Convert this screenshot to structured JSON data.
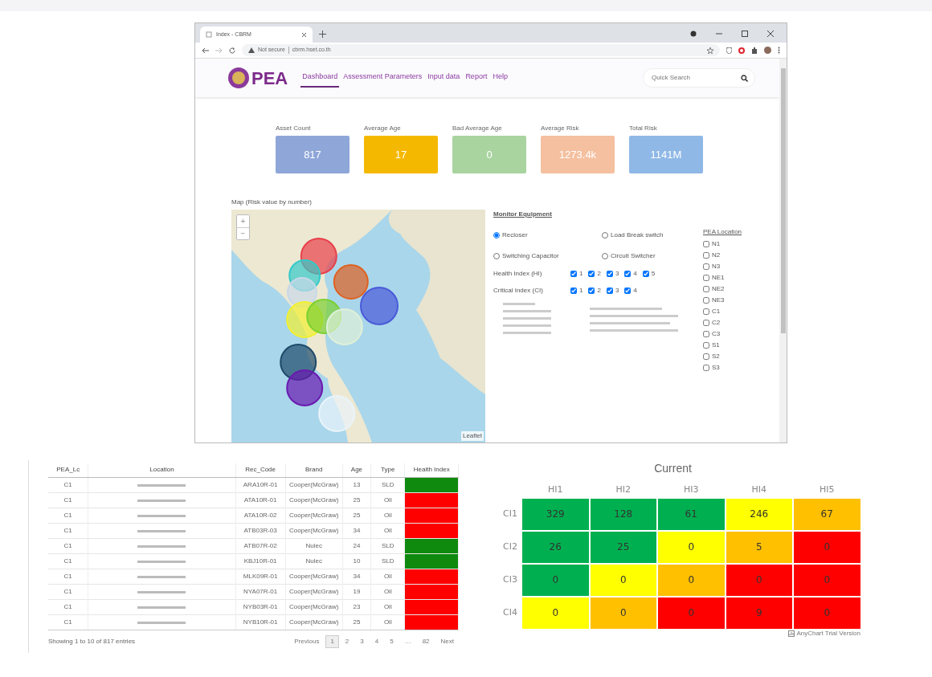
{
  "browser": {
    "tab_title": "Index - CBRM",
    "address_security": "Not secure",
    "address_url": "cbrm.hset.co.th"
  },
  "navbar": {
    "logo_text": "PEA",
    "links": [
      {
        "label": "Dashboard",
        "selected": true
      },
      {
        "label": "Assessment Parameters",
        "selected": false
      },
      {
        "label": "Input data",
        "selected": false
      },
      {
        "label": "Report",
        "selected": false
      },
      {
        "label": "Help",
        "selected": false
      }
    ],
    "search": {
      "placeholder": "Quick Search"
    }
  },
  "kpis": [
    {
      "label": "Asset Count",
      "value": "817",
      "color": "#8fa6d8"
    },
    {
      "label": "Average Age",
      "value": "17",
      "color": "#f5b800"
    },
    {
      "label": "Bad Average Age",
      "value": "0",
      "color": "#a9d4a0"
    },
    {
      "label": "Average Risk",
      "value": "1273.4k",
      "color": "#f4c0a0"
    },
    {
      "label": "Total Risk",
      "value": "1141M",
      "color": "#8fb8e6"
    }
  ],
  "map": {
    "title": "Map (Risk value by number)",
    "zoom_in": "+",
    "zoom_out": "−",
    "attribution": "Leaflet"
  },
  "monitor": {
    "title": "Monitor Equipment",
    "equipment": [
      {
        "label": "Recloser",
        "selected": true
      },
      {
        "label": "Load Break switch",
        "selected": false
      },
      {
        "label": "Switching Capacitor",
        "selected": false
      },
      {
        "label": "Circuit Switcher",
        "selected": false
      }
    ],
    "health_index": {
      "label": "Health Index (HI)",
      "options": [
        {
          "label": "1",
          "checked": true
        },
        {
          "label": "2",
          "checked": true
        },
        {
          "label": "3",
          "checked": true
        },
        {
          "label": "4",
          "checked": true
        },
        {
          "label": "5",
          "checked": true
        }
      ]
    },
    "critical_index": {
      "label": "Critical Index (CI)",
      "options": [
        {
          "label": "1",
          "checked": true
        },
        {
          "label": "2",
          "checked": true
        },
        {
          "label": "3",
          "checked": true
        },
        {
          "label": "4",
          "checked": true
        }
      ]
    },
    "location_title": "PEA Location",
    "locations": [
      {
        "label": "N1",
        "checked": false
      },
      {
        "label": "N2",
        "checked": false
      },
      {
        "label": "N3",
        "checked": false
      },
      {
        "label": "NE1",
        "checked": false
      },
      {
        "label": "NE2",
        "checked": false
      },
      {
        "label": "NE3",
        "checked": false
      },
      {
        "label": "C1",
        "checked": false
      },
      {
        "label": "C2",
        "checked": false
      },
      {
        "label": "C3",
        "checked": false
      },
      {
        "label": "S1",
        "checked": false
      },
      {
        "label": "S2",
        "checked": false
      },
      {
        "label": "S3",
        "checked": false
      }
    ]
  },
  "table": {
    "columns": [
      "PEA_Lc",
      "Location",
      "Rec_Code",
      "Brand",
      "Age",
      "Type",
      "Health Index"
    ],
    "rows": [
      {
        "pea_lc": "C1",
        "rec_code": "ARA10R-01",
        "brand": "Cooper(McGraw)",
        "age": "13",
        "type": "SLD",
        "color": "#0f8a0f"
      },
      {
        "pea_lc": "C1",
        "rec_code": "ATA10R-01",
        "brand": "Cooper(McGraw)",
        "age": "25",
        "type": "Oil",
        "color": "#ff0000"
      },
      {
        "pea_lc": "C1",
        "rec_code": "ATA10R-02",
        "brand": "Cooper(McGraw)",
        "age": "25",
        "type": "Oil",
        "color": "#ff0000"
      },
      {
        "pea_lc": "C1",
        "rec_code": "ATB03R-03",
        "brand": "Cooper(McGraw)",
        "age": "34",
        "type": "Oil",
        "color": "#ff0000"
      },
      {
        "pea_lc": "C1",
        "rec_code": "ATB07R-02",
        "brand": "Nulec",
        "age": "24",
        "type": "SLD",
        "color": "#0f8a0f"
      },
      {
        "pea_lc": "C1",
        "rec_code": "KBJ10R-01",
        "brand": "Nulec",
        "age": "10",
        "type": "SLD",
        "color": "#0f8a0f"
      },
      {
        "pea_lc": "C1",
        "rec_code": "MLK09R-01",
        "brand": "Cooper(McGraw)",
        "age": "34",
        "type": "Oil",
        "color": "#ff0000"
      },
      {
        "pea_lc": "C1",
        "rec_code": "NYA07R-01",
        "brand": "Cooper(McGraw)",
        "age": "19",
        "type": "Oil",
        "color": "#ff0000"
      },
      {
        "pea_lc": "C1",
        "rec_code": "NYB03R-01",
        "brand": "Cooper(McGraw)",
        "age": "23",
        "type": "Oil",
        "color": "#ff0000"
      },
      {
        "pea_lc": "C1",
        "rec_code": "NYB10R-01",
        "brand": "Cooper(McGraw)",
        "age": "25",
        "type": "Oil",
        "color": "#ff0000"
      }
    ],
    "info": "Showing 1 to 10 of 817 entries",
    "pagination": [
      {
        "label": "Previous",
        "selected": false
      },
      {
        "label": "1",
        "selected": true
      },
      {
        "label": "2",
        "selected": false
      },
      {
        "label": "3",
        "selected": false
      },
      {
        "label": "4",
        "selected": false
      },
      {
        "label": "5",
        "selected": false
      },
      {
        "label": "…",
        "selected": false
      },
      {
        "label": "82",
        "selected": false
      },
      {
        "label": "Next",
        "selected": false
      }
    ]
  },
  "heatmap": {
    "title": "Current",
    "columns": [
      "HI1",
      "HI2",
      "HI3",
      "HI4",
      "HI5"
    ],
    "rows": [
      {
        "label": "CI1",
        "cells": [
          {
            "value": "329",
            "color": "#00b050"
          },
          {
            "value": "128",
            "color": "#00b050"
          },
          {
            "value": "61",
            "color": "#00b050"
          },
          {
            "value": "246",
            "color": "#ffff00"
          },
          {
            "value": "67",
            "color": "#ffc000"
          }
        ]
      },
      {
        "label": "CI2",
        "cells": [
          {
            "value": "26",
            "color": "#00b050"
          },
          {
            "value": "25",
            "color": "#00b050"
          },
          {
            "value": "0",
            "color": "#ffff00"
          },
          {
            "value": "5",
            "color": "#ffc000"
          },
          {
            "value": "0",
            "color": "#ff0000"
          }
        ]
      },
      {
        "label": "CI3",
        "cells": [
          {
            "value": "0",
            "color": "#00b050"
          },
          {
            "value": "0",
            "color": "#ffff00"
          },
          {
            "value": "0",
            "color": "#ffc000"
          },
          {
            "value": "0",
            "color": "#ff0000"
          },
          {
            "value": "0",
            "color": "#ff0000"
          }
        ]
      },
      {
        "label": "CI4",
        "cells": [
          {
            "value": "0",
            "color": "#ffff00"
          },
          {
            "value": "0",
            "color": "#ffc000"
          },
          {
            "value": "0",
            "color": "#ff0000"
          },
          {
            "value": "9",
            "color": "#ff0000"
          },
          {
            "value": "0",
            "color": "#ff0000"
          }
        ]
      }
    ],
    "credit": "AnyChart Trial Version"
  }
}
